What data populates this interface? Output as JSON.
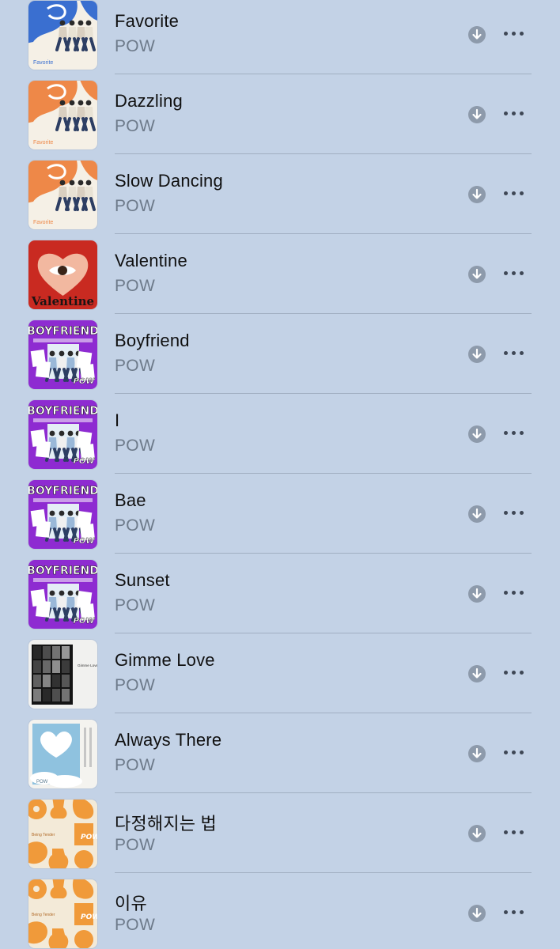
{
  "songs": [
    {
      "title": "Favorite",
      "artist": "POW",
      "art": "favorite-blue"
    },
    {
      "title": "Dazzling",
      "artist": "POW",
      "art": "favorite-orange"
    },
    {
      "title": "Slow Dancing",
      "artist": "POW",
      "art": "favorite-orange"
    },
    {
      "title": "Valentine",
      "artist": "POW",
      "art": "valentine"
    },
    {
      "title": "Boyfriend",
      "artist": "POW",
      "art": "boyfriend"
    },
    {
      "title": "I",
      "artist": "POW",
      "art": "boyfriend"
    },
    {
      "title": "Bae",
      "artist": "POW",
      "art": "boyfriend"
    },
    {
      "title": "Sunset",
      "artist": "POW",
      "art": "boyfriend"
    },
    {
      "title": "Gimme Love",
      "artist": "POW",
      "art": "gimme-love"
    },
    {
      "title": "Always There",
      "artist": "POW",
      "art": "always-there"
    },
    {
      "title": "다정해지는 법",
      "artist": "POW",
      "art": "being-tender"
    },
    {
      "title": "이유",
      "artist": "POW",
      "art": "being-tender"
    }
  ],
  "artwork_text": {
    "favorite": "Favorite",
    "valentine": "Valentine",
    "boyfriend": "BOYFRIEND",
    "pow": "POW",
    "gimme_love": "Gimme Love",
    "being_tender": "Being Tender"
  },
  "colors": {
    "background": "#c3d2e6",
    "separator": "#a1afc2",
    "artist_text": "#6d7a8a",
    "download_icon": "#8d9aab",
    "more_icon": "#3e4755"
  },
  "icons": {
    "download": "download-icon",
    "more": "more-icon"
  }
}
